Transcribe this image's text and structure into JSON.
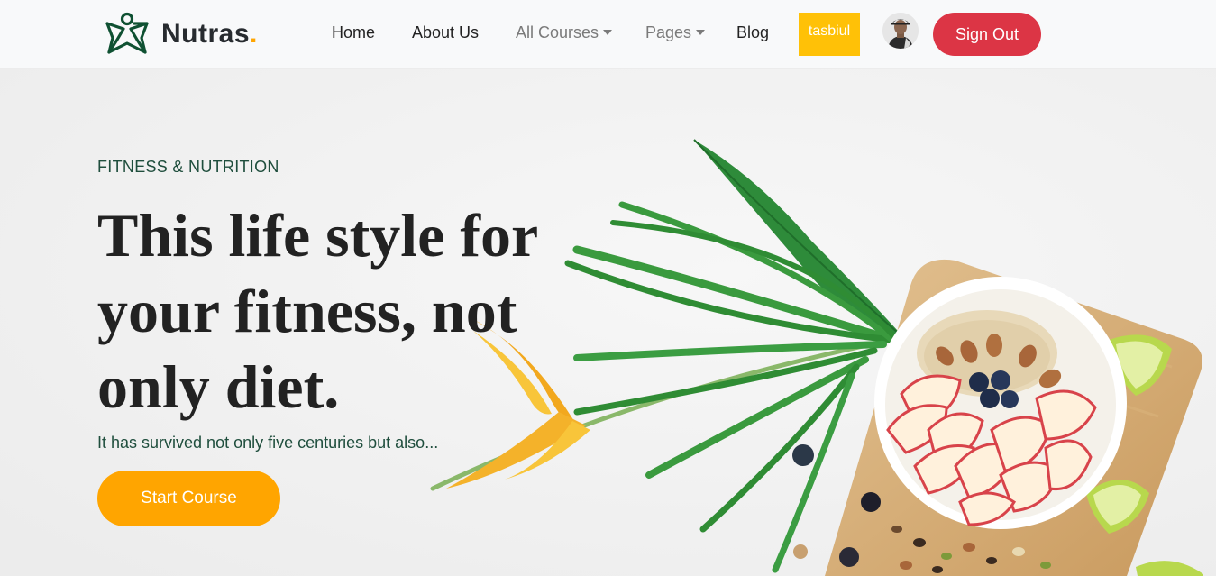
{
  "brand": {
    "name": "Nutras",
    "dot": ".",
    "logo_icon": "person-star-logo-icon"
  },
  "nav": {
    "home": "Home",
    "about": "About Us",
    "courses": "All Courses",
    "pages": "Pages",
    "blog": "Blog",
    "user": "tasbiul",
    "avatar_icon": "user-avatar-icon",
    "signout": "Sign Out"
  },
  "hero": {
    "eyebrow": "FITNESS & NUTRITION",
    "headline": "This life style for your fitness, not only diet.",
    "subtext": "It has survived not only five centuries but also...",
    "cta": "Start Course"
  },
  "colors": {
    "brand_green": "#0f5132",
    "accent_orange": "#ffa500",
    "signout_red": "#dc3545",
    "user_yellow": "#ffc107",
    "hero_text_green": "#1f4e3d"
  }
}
